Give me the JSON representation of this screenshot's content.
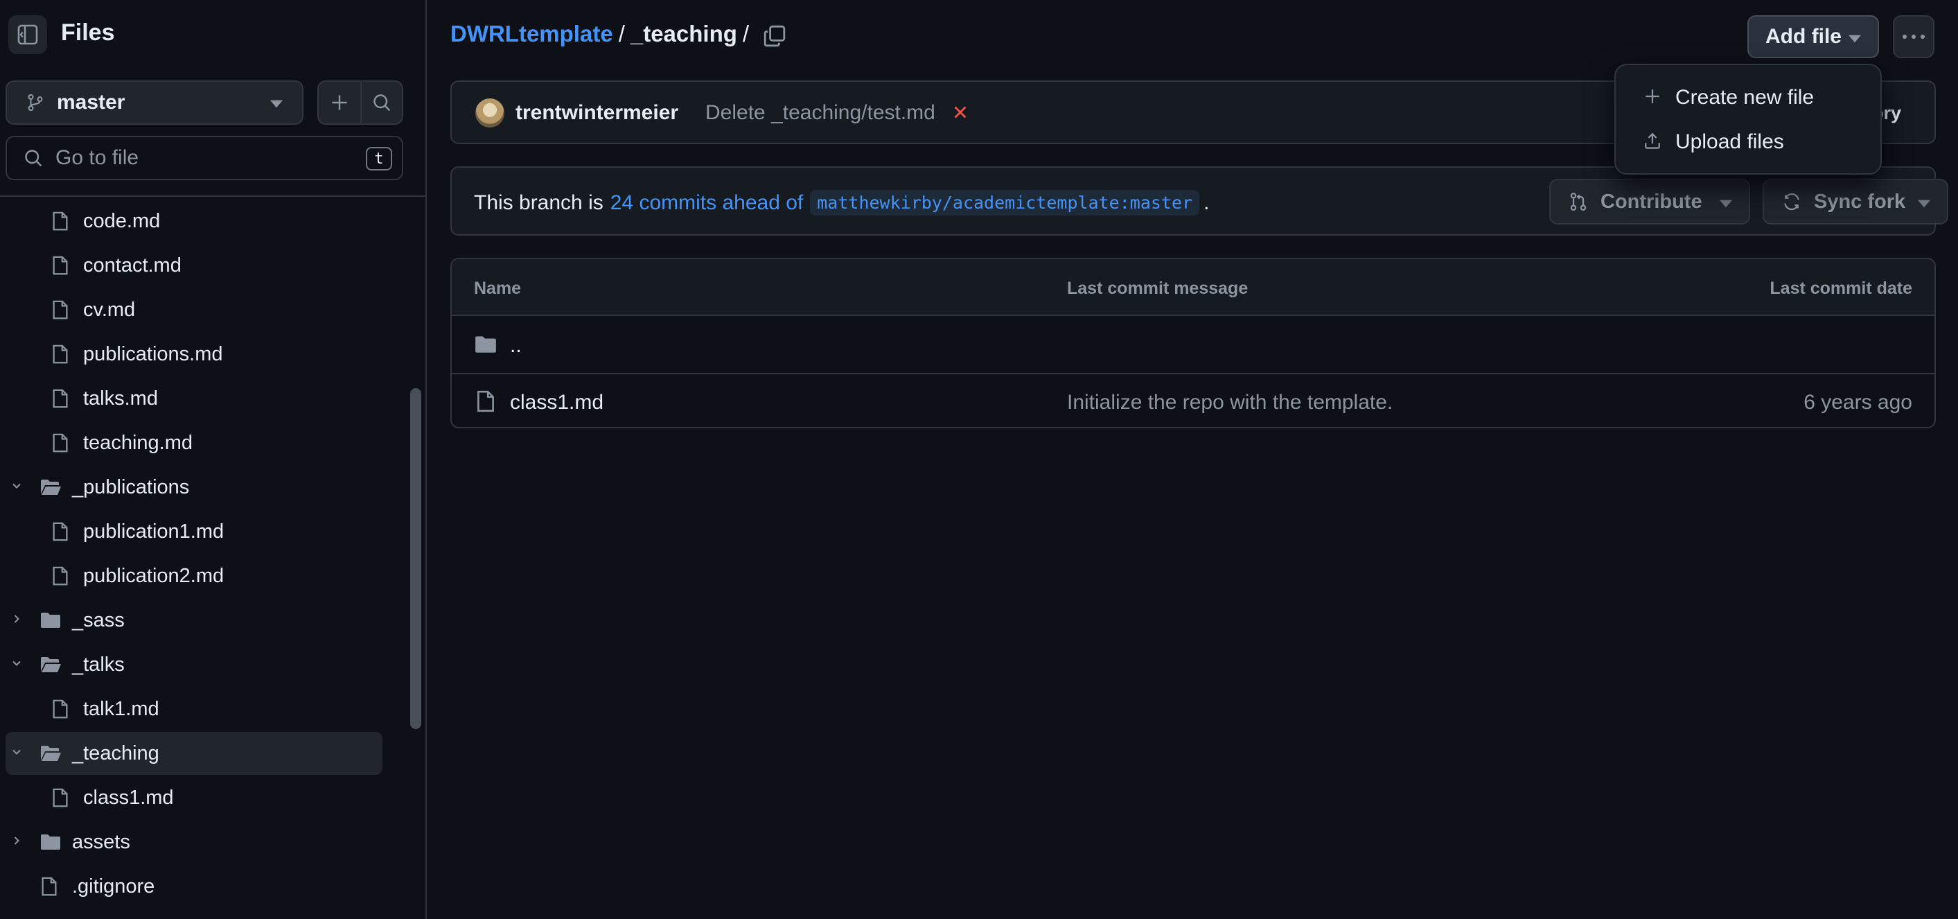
{
  "sidebar": {
    "title": "Files",
    "branch": "master",
    "goto_placeholder": "Go to file",
    "goto_shortcut": "t",
    "tree": [
      {
        "name": "code.md",
        "type": "file"
      },
      {
        "name": "contact.md",
        "type": "file"
      },
      {
        "name": "cv.md",
        "type": "file"
      },
      {
        "name": "publications.md",
        "type": "file"
      },
      {
        "name": "talks.md",
        "type": "file"
      },
      {
        "name": "teaching.md",
        "type": "file"
      },
      {
        "name": "_publications",
        "type": "folder-open"
      },
      {
        "name": "publication1.md",
        "type": "file"
      },
      {
        "name": "publication2.md",
        "type": "file"
      },
      {
        "name": "_sass",
        "type": "folder-closed"
      },
      {
        "name": "_talks",
        "type": "folder-open"
      },
      {
        "name": "talk1.md",
        "type": "file"
      },
      {
        "name": "_teaching",
        "type": "folder-open",
        "selected": true
      },
      {
        "name": "class1.md",
        "type": "file"
      },
      {
        "name": "assets",
        "type": "folder-closed"
      },
      {
        "name": ".gitignore",
        "type": "file"
      }
    ]
  },
  "breadcrumb": {
    "repo": "DWRLtemplate",
    "sep1": "/",
    "folder": "_teaching",
    "sep2": "/"
  },
  "toolbar": {
    "add_file_label": "Add file"
  },
  "add_file_menu": {
    "items": [
      {
        "label": "Create new file",
        "icon": "plus-icon"
      },
      {
        "label": "Upload files",
        "icon": "upload-icon"
      }
    ]
  },
  "latest_commit": {
    "author": "trentwintermeier",
    "message": "Delete _teaching/test.md",
    "status": "failed",
    "history_label_partial": "ory"
  },
  "branch_status": {
    "prefix": "This branch is",
    "ahead_link": "24 commits ahead of",
    "upstream": "matthewkirby/academictemplate:master",
    "suffix": ".",
    "contribute_label": "Contribute",
    "sync_label": "Sync fork"
  },
  "file_table": {
    "columns": [
      "Name",
      "Last commit message",
      "Last commit date"
    ],
    "rows": [
      {
        "name": "..",
        "type": "parent",
        "message": "",
        "date": ""
      },
      {
        "name": "class1.md",
        "type": "file",
        "message": "Initialize the repo with the template.",
        "date": "6 years ago"
      }
    ]
  },
  "colors": {
    "background": "#0d1117",
    "accent_link": "#4493f8",
    "border": "#30363d",
    "muted_text": "#8d96a0",
    "error": "#f85149"
  }
}
